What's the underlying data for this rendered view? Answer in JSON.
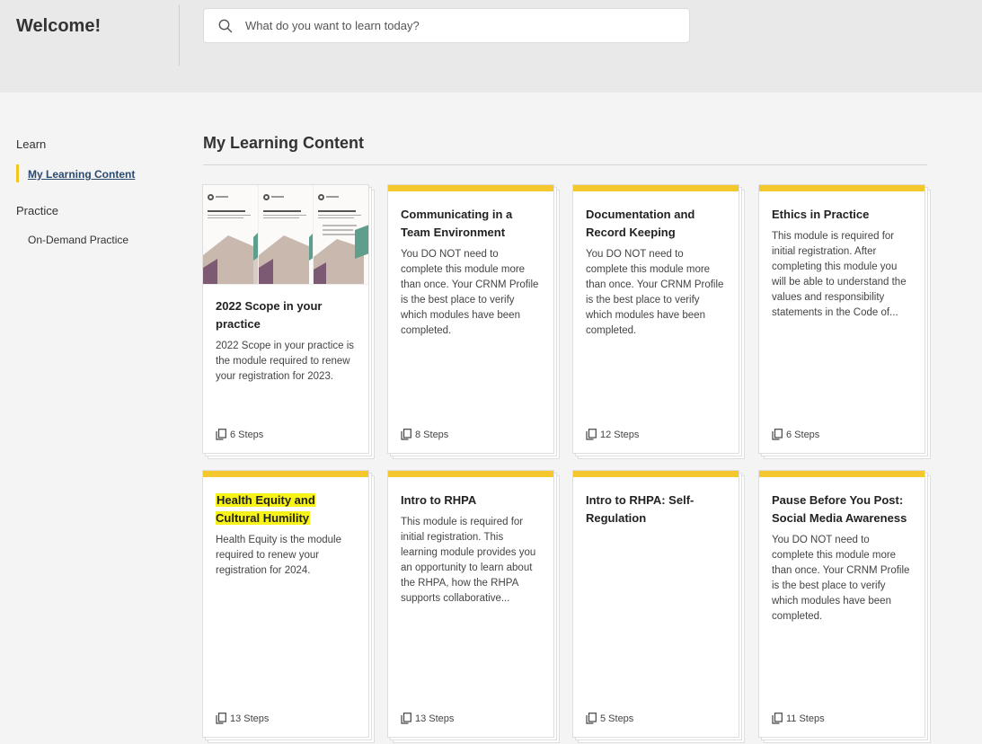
{
  "header": {
    "welcome": "Welcome!",
    "search_placeholder": "What do you want to learn today?"
  },
  "sidebar": {
    "learn_heading": "Learn",
    "learn_items": [
      {
        "label": "My Learning Content",
        "active": true
      }
    ],
    "practice_heading": "Practice",
    "practice_items": [
      {
        "label": "On-Demand Practice",
        "active": false
      }
    ]
  },
  "main": {
    "title": "My Learning Content",
    "cards": [
      {
        "title": "2022 Scope in your practice",
        "description": "2022 Scope in your practice is the module required to renew your registration for 2023.",
        "steps": "6 Steps",
        "has_thumbnail": true
      },
      {
        "title": "Communicating in a Team Environment",
        "description": "You DO NOT need to complete this module more than once. Your CRNM Profile is the best place to verify which modules have been completed.",
        "steps": "8 Steps"
      },
      {
        "title": "Documentation and Record Keeping",
        "description": "You DO NOT need to complete this module more than once. Your CRNM Profile is the best place to verify which modules have been completed.",
        "steps": "12 Steps"
      },
      {
        "title": "Ethics in Practice",
        "description": "This module is required for initial registration. After completing this module you will be able to understand the values and responsibility statements in the Code of...",
        "steps": "6 Steps"
      },
      {
        "title": "Health Equity and Cultural Humility",
        "description": "Health Equity is the module required to renew your registration for 2024.",
        "steps": "13 Steps",
        "highlighted": true
      },
      {
        "title": "Intro to RHPA",
        "description": "This module is required for initial registration. This learning module provides you an opportunity to learn about the RHPA, how the RHPA supports collaborative...",
        "steps": "13 Steps"
      },
      {
        "title": "Intro to RHPA: Self-Regulation",
        "description": "",
        "steps": "5 Steps"
      },
      {
        "title": "Pause Before You Post: Social Media Awareness",
        "description": "You DO NOT need to complete this module more than once. Your CRNM Profile is the best place to verify which modules have been completed.",
        "steps": "11 Steps"
      }
    ]
  },
  "colors": {
    "accent_bar": "#f5c72e",
    "active_nav": "#2b4a6f",
    "highlight": "#f7f218"
  }
}
